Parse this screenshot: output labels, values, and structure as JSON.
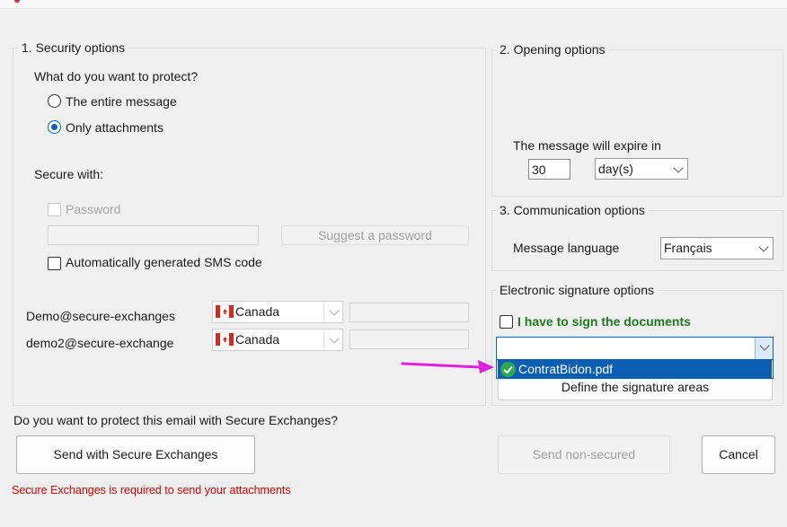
{
  "security": {
    "title": "1. Security options",
    "question": "What do you want to protect?",
    "radio_entire": "The entire message",
    "radio_attachments": "Only attachments",
    "selected": "Only attachments",
    "secure_with": "Secure with:",
    "password_label": "Password",
    "suggest_password": "Suggest a password",
    "sms_label": "Automatically generated SMS code",
    "recipients": [
      {
        "email": "Demo@secure-exchanges",
        "country": "Canada"
      },
      {
        "email": "demo2@secure-exchange",
        "country": "Canada"
      }
    ]
  },
  "opening": {
    "title": "2. Opening options",
    "expire_label": "The message will expire in",
    "expire_value": "30",
    "expire_unit": "day(s)"
  },
  "communication": {
    "title": "3. Communication options",
    "language_label": "Message language",
    "language_value": "Français"
  },
  "signature": {
    "title": "Electronic signature options",
    "sign_label": "I have to sign the documents",
    "sign_color": "#1f7a1f",
    "dropdown_value": "",
    "option": "ContratBidon.pdf",
    "define_button": "Define the signature areas",
    "highlight_color": "#0a5fb4",
    "arrow_color": "#e020e0"
  },
  "footer": {
    "question": "Do you want to protect this email with Secure Exchanges?",
    "send_secure": "Send with Secure Exchanges",
    "send_non_secure": "Send non-secured",
    "cancel": "Cancel",
    "warning": "Secure Exchanges is required to send your attachments",
    "warning_color": "#d40000"
  }
}
